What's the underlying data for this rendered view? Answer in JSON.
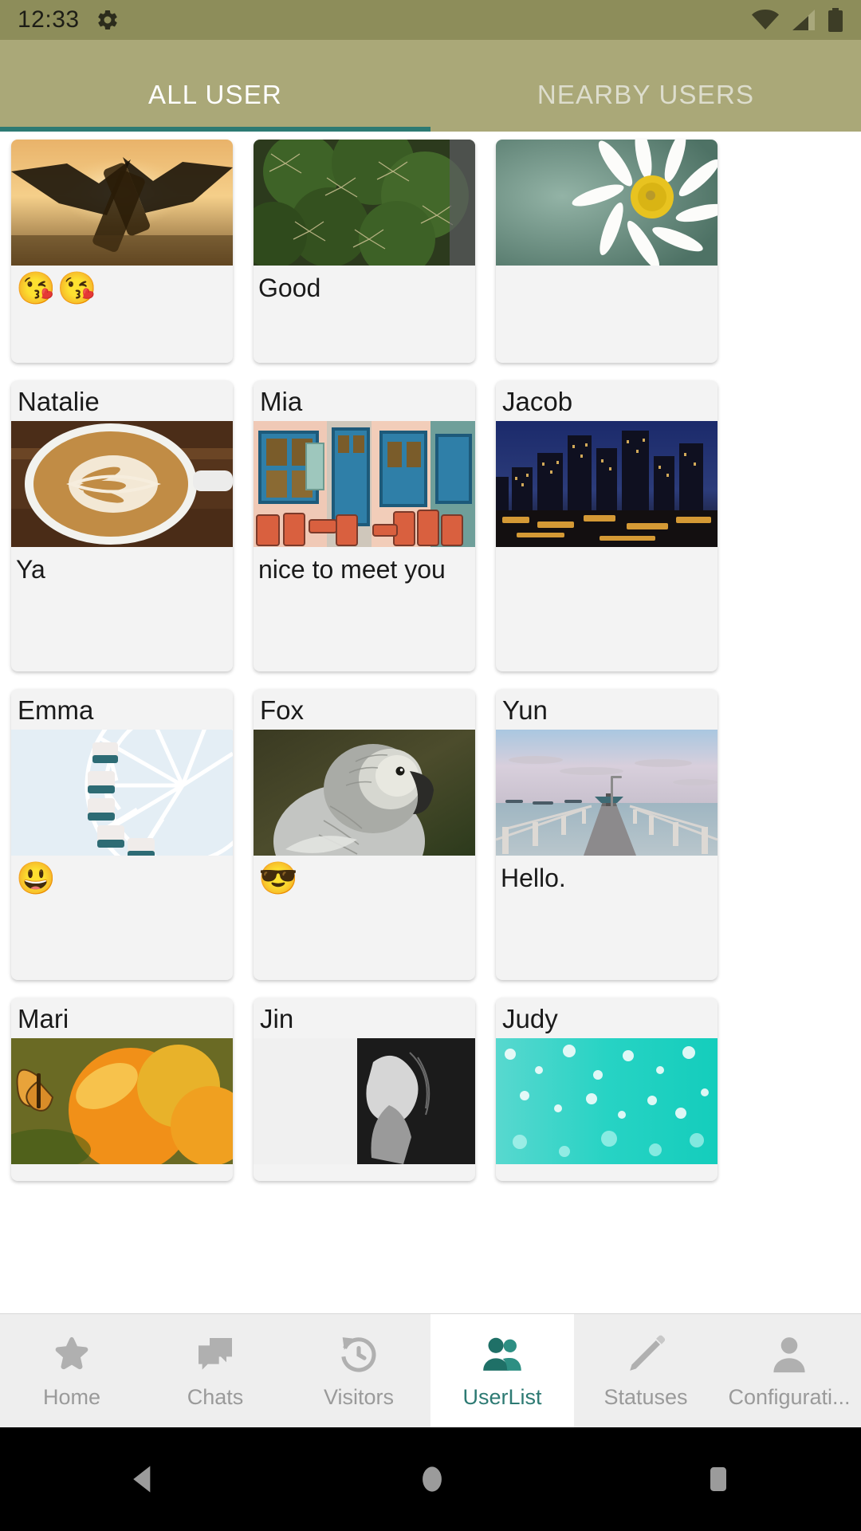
{
  "status_bar": {
    "time": "12:33",
    "icons": [
      "gear-icon",
      "wifi-icon",
      "cellular-signal-icon",
      "battery-icon"
    ],
    "background_color": "#8d8d5a"
  },
  "tabs": {
    "items": [
      {
        "label": "ALL USER",
        "active": true
      },
      {
        "label": "NEARBY USERS",
        "active": false
      }
    ],
    "background_color": "#aaa878",
    "indicator_color": "#2d7a73"
  },
  "user_cards": [
    {
      "name": "",
      "message": "😘😘",
      "photo": "beer-cheers-sunset",
      "layout": "photo-first"
    },
    {
      "name": "",
      "message": "Good",
      "photo": "cactus-closeup",
      "layout": "photo-first"
    },
    {
      "name": "",
      "message": "",
      "photo": "white-daisy-flower",
      "layout": "photo-first"
    },
    {
      "name": "Natalie",
      "message": "Ya",
      "photo": "latte-art-coffee",
      "layout": "name-first"
    },
    {
      "name": "Mia",
      "message": "nice to meet you",
      "photo": "greek-cafe-blue-doors",
      "layout": "name-first"
    },
    {
      "name": "Jacob",
      "message": "",
      "photo": "city-skyline-night",
      "layout": "name-first"
    },
    {
      "name": "Emma",
      "message": "😃",
      "photo": "ferris-wheel",
      "layout": "name-first"
    },
    {
      "name": "Fox",
      "message": "😎",
      "photo": "grey-parrot",
      "layout": "name-first"
    },
    {
      "name": "Yun",
      "message": "Hello.",
      "photo": "ocean-pier-sunset",
      "layout": "name-first"
    },
    {
      "name": "Mari",
      "message": "",
      "photo": "butterfly-orange-flower",
      "layout": "name-first"
    },
    {
      "name": "Jin",
      "message": "",
      "photo": "black-white-portrait",
      "layout": "name-first"
    },
    {
      "name": "Judy",
      "message": "",
      "photo": "turquoise-water-droplets",
      "layout": "name-first"
    }
  ],
  "bottom_nav": {
    "items": [
      {
        "label": "Home",
        "icon": "star-icon",
        "active": false
      },
      {
        "label": "Chats",
        "icon": "chat-bubbles-icon",
        "active": false
      },
      {
        "label": "Visitors",
        "icon": "history-clock-icon",
        "active": false
      },
      {
        "label": "UserList",
        "icon": "people-icon",
        "active": true
      },
      {
        "label": "Statuses",
        "icon": "pencil-icon",
        "active": false
      },
      {
        "label": "Configurati...",
        "icon": "person-icon",
        "active": false
      }
    ],
    "active_color": "#2d7a73",
    "inactive_color": "#9a9a9a"
  },
  "system_nav": {
    "buttons": [
      "back-triangle-icon",
      "home-circle-icon",
      "recents-square-icon"
    ]
  }
}
